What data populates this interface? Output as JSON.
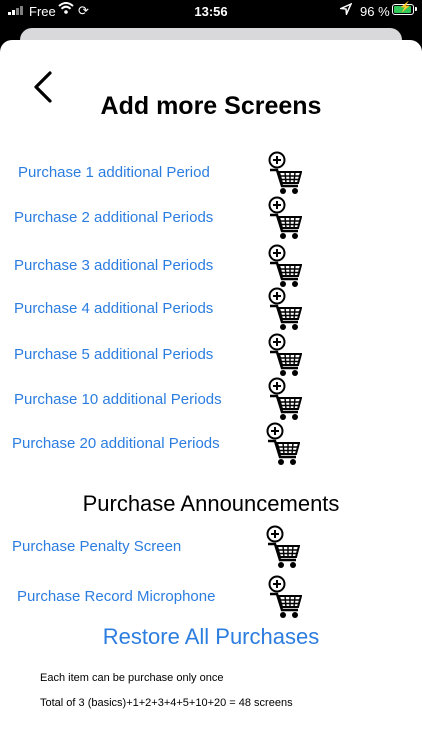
{
  "status_bar": {
    "carrier": "Free",
    "time": "13:56",
    "battery_percent": "96 %",
    "battery_color": "#34c759",
    "icons": [
      "signal-icon",
      "wifi-icon",
      "sync-icon",
      "location-arrow-icon",
      "battery-charging-icon"
    ]
  },
  "header": {
    "back_icon": "chevron-left-icon",
    "title": "Add more Screens"
  },
  "purchases": [
    {
      "label": "Purchase 1 additional Period",
      "icon": "add-to-cart-icon"
    },
    {
      "label": "Purchase 2 additional Periods",
      "icon": "add-to-cart-icon"
    },
    {
      "label": "Purchase 3 additional Periods",
      "icon": "add-to-cart-icon"
    },
    {
      "label": "Purchase 4 additional Periods",
      "icon": "add-to-cart-icon"
    },
    {
      "label": "Purchase 5 additional Periods",
      "icon": "add-to-cart-icon"
    },
    {
      "label": "Purchase 10 additional Periods",
      "icon": "add-to-cart-icon"
    },
    {
      "label": "Purchase 20 additional Periods",
      "icon": "add-to-cart-icon"
    }
  ],
  "announcements": {
    "title": "Purchase Announcements",
    "items": [
      {
        "label": "Purchase Penalty Screen",
        "icon": "add-to-cart-icon"
      },
      {
        "label": "Purchase Record Microphone",
        "icon": "add-to-cart-icon"
      }
    ]
  },
  "restore_label": "Restore All Purchases",
  "notes": {
    "line1": "Each item can be purchase only once",
    "line2": "Total of 3 (basics)+1+2+3+4+5+10+20 = 48 screens"
  },
  "colors": {
    "link": "#2c7de0",
    "sheet_background": "#ffffff",
    "screen_background": "#000000"
  }
}
